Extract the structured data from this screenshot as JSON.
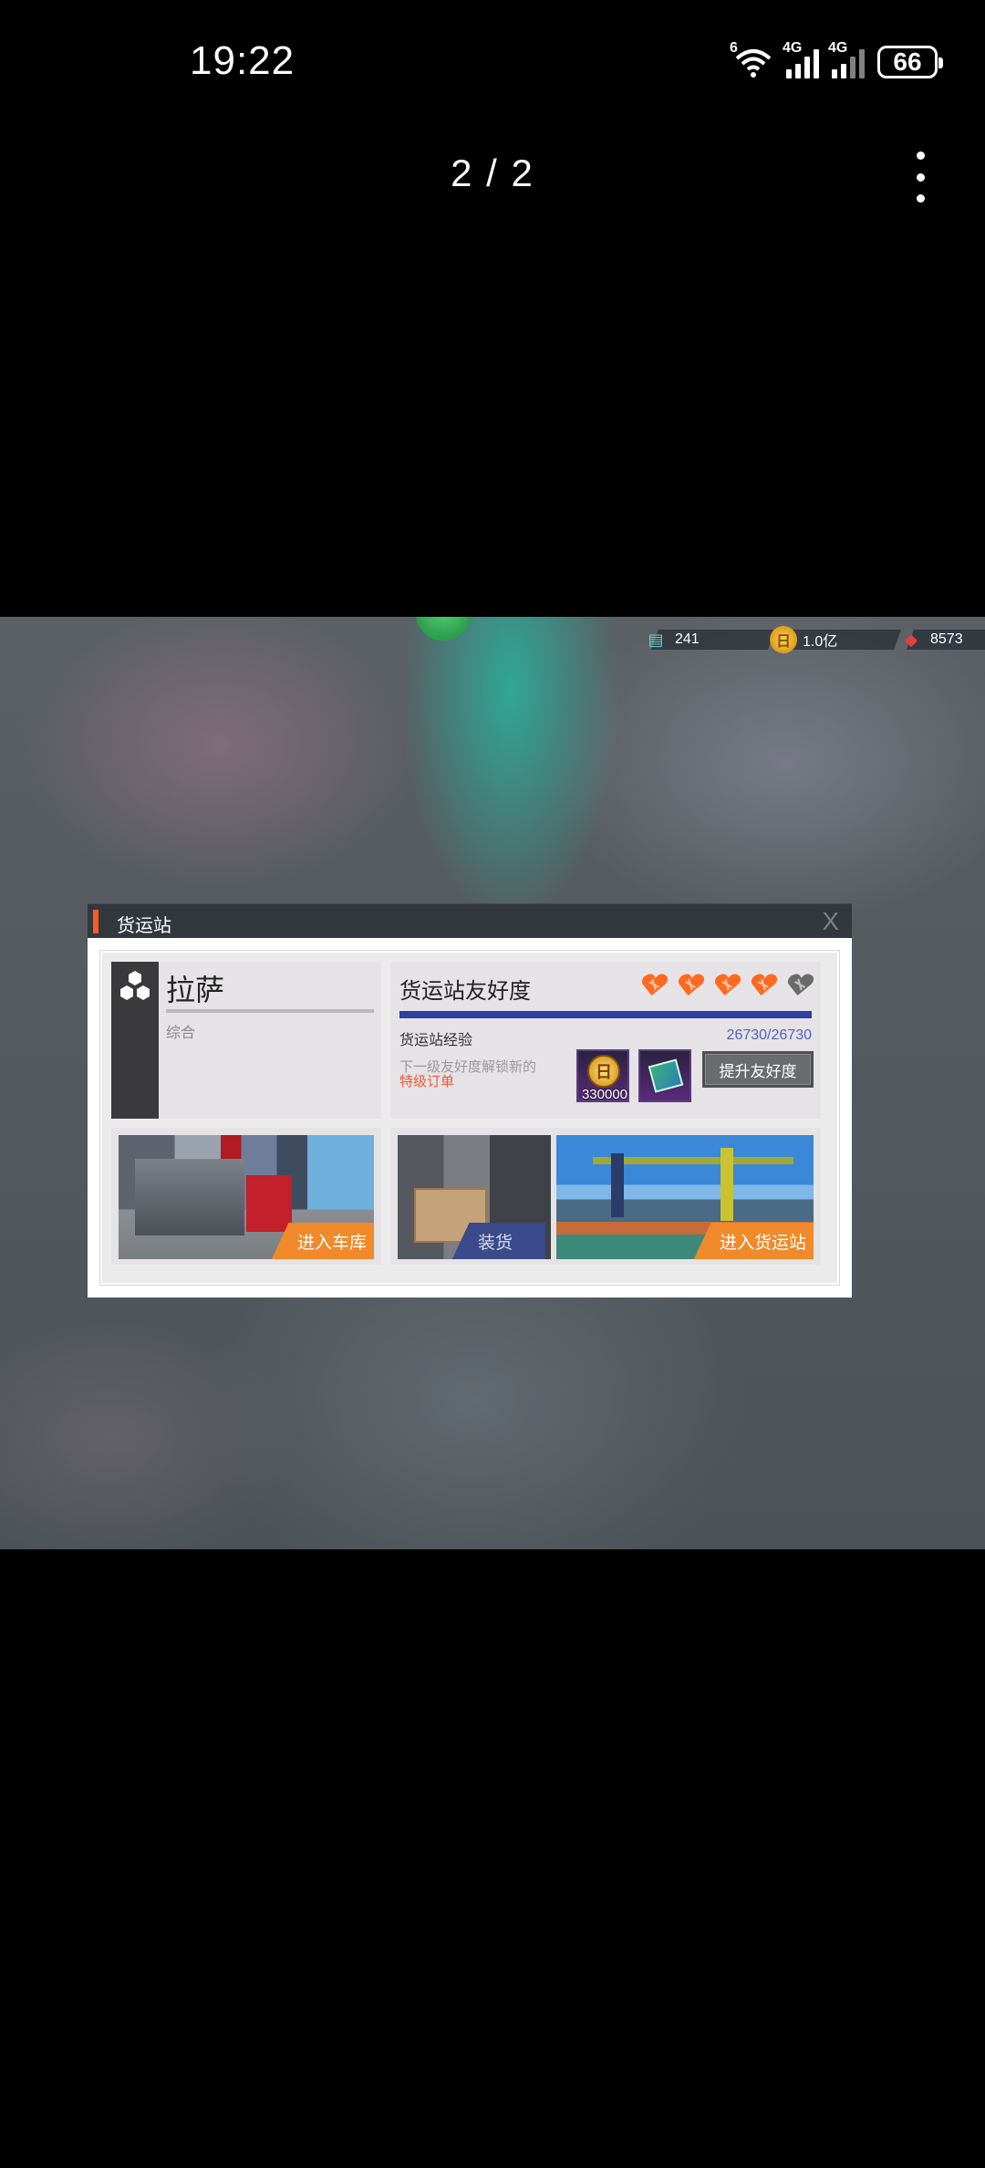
{
  "status_bar": {
    "time": "19:22",
    "wifi_label": "6",
    "signal1_label": "4G",
    "signal2_label": "4G",
    "battery": "66"
  },
  "viewer": {
    "page_indicator": "2 / 2",
    "more_icon": "more-vertical-icon"
  },
  "game": {
    "currencies": {
      "tickets": "241",
      "gold": "1.0亿",
      "gems": "8573"
    },
    "dialog": {
      "title": "货运站",
      "close": "X",
      "station": {
        "name": "拉萨",
        "type": "综合"
      },
      "friendship": {
        "title": "货运站友好度",
        "hearts_filled": 4,
        "hearts_total": 5,
        "exp_label": "货运站经验",
        "exp_value": "26730/26730",
        "next_level_text": "下一级友好度解锁新的",
        "next_level_highlight": "特级订单",
        "reward_gold_amount": "330000",
        "reward_gold_symbol": "日",
        "upgrade_button": "提升友好度"
      },
      "garage_button": "进入车库",
      "load_button": "装货",
      "station_button": "进入货运站"
    }
  },
  "colors": {
    "accent_orange": "#f08a2a",
    "heart_orange": "#ff6a20",
    "bar_blue": "#2d3f9f"
  }
}
